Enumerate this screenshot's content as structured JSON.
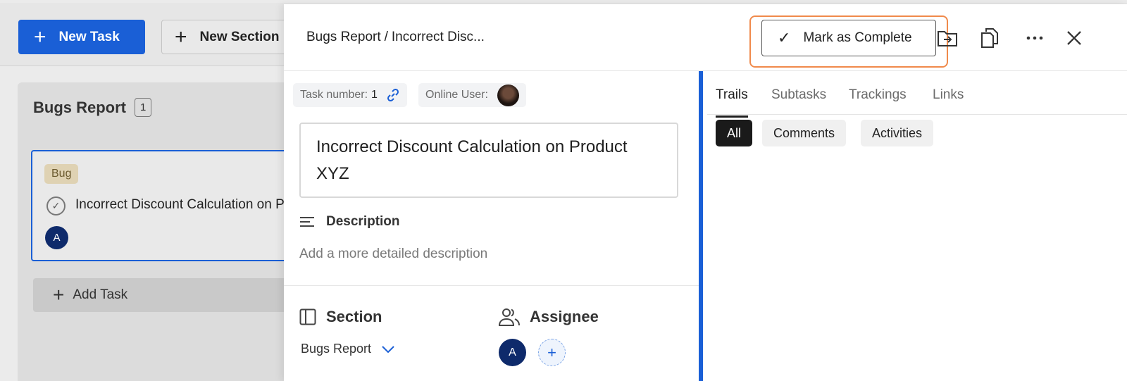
{
  "board": {
    "new_task_label": "New Task",
    "new_section_label": "New Section",
    "column": {
      "title": "Bugs Report",
      "count": "1",
      "add_task_label": "Add Task"
    },
    "card": {
      "tag": "Bug",
      "title": "Incorrect Discount Calculation on Product XYZ",
      "assignee_initial": "A"
    }
  },
  "drawer": {
    "breadcrumb": {
      "parent": "Bugs Report",
      "separator": "/",
      "current": "Incorrect Disc..."
    },
    "mark_complete_label": "Mark as Complete",
    "task_number_label": "Task number:",
    "task_number_value": "1",
    "online_user_label": "Online User:",
    "title": "Incorrect Discount Calculation on Product XYZ",
    "description_heading": "Description",
    "description_placeholder": "Add a more detailed description",
    "section_heading": "Section",
    "section_value": "Bugs Report",
    "assignee_heading": "Assignee",
    "assignee_initial": "A",
    "add_assignee_symbol": "+",
    "tabs": [
      "Trails",
      "Subtasks",
      "Trackings",
      "Links"
    ],
    "active_tab": "Trails",
    "filters": [
      "All",
      "Comments",
      "Activities"
    ],
    "active_filter": "All"
  },
  "colors": {
    "accent": "#1a5fd6",
    "highlight": "#f08a4b",
    "assignee_avatar": "#0e2a6b"
  }
}
